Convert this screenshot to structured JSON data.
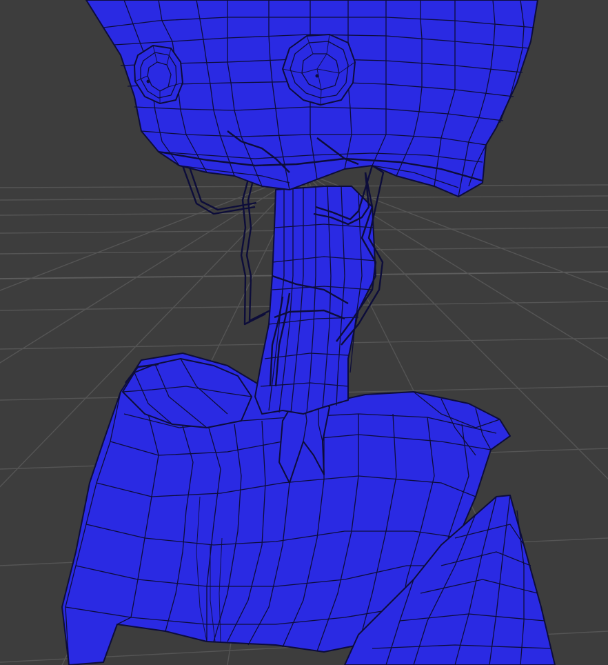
{
  "viewport": {
    "background": "#3d3d3d",
    "grid_color": "#555555",
    "mesh_color": "#2a2ae3",
    "wireframe_color": "#0d0d3a",
    "shading_mode": "wireframe-overlay",
    "grid_visible": true
  },
  "model": {
    "icon": "mesh-object-icon",
    "parts": [
      "head",
      "left-eye",
      "right-eye",
      "neck",
      "neck-cables",
      "shoulders",
      "torso",
      "right-arm"
    ]
  }
}
